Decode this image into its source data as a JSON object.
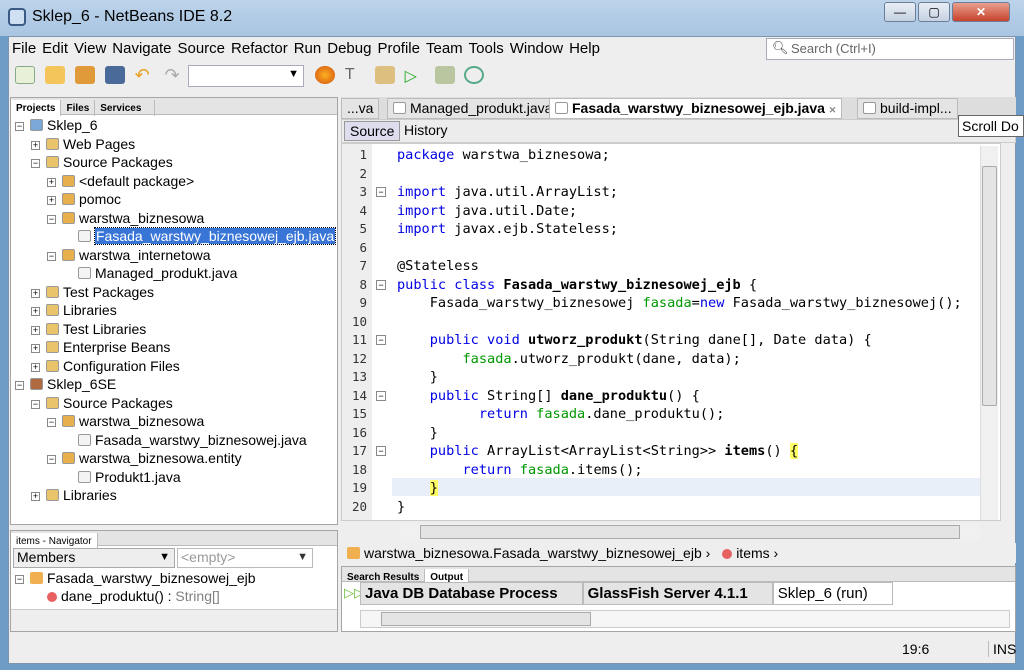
{
  "window": {
    "title": "Sklep_6 - NetBeans IDE 8.2"
  },
  "menu": [
    "File",
    "Edit",
    "View",
    "Navigate",
    "Source",
    "Refactor",
    "Run",
    "Debug",
    "Profile",
    "Team",
    "Tools",
    "Window",
    "Help"
  ],
  "search": {
    "placeholder": "Search (Ctrl+I)"
  },
  "projects": {
    "tabs": [
      "Projects",
      "Files",
      "Services"
    ],
    "tree": [
      {
        "label": "Sklep_6",
        "level": 0,
        "icon": "globe-icon"
      },
      {
        "label": "Web Pages",
        "level": 1,
        "icon": "folder-icon"
      },
      {
        "label": "Source Packages",
        "level": 1,
        "icon": "folder-icon"
      },
      {
        "label": "<default package>",
        "level": 2,
        "icon": "package-icon"
      },
      {
        "label": "pomoc",
        "level": 2,
        "icon": "package-icon"
      },
      {
        "label": "warstwa_biznesowa",
        "level": 2,
        "icon": "package-icon"
      },
      {
        "label": "Fasada_warstwy_biznesowej_ejb.java",
        "level": 3,
        "icon": "java-file-icon",
        "selected": true
      },
      {
        "label": "warstwa_internetowa",
        "level": 2,
        "icon": "package-icon"
      },
      {
        "label": "Managed_produkt.java",
        "level": 3,
        "icon": "java-file-icon"
      },
      {
        "label": "Test Packages",
        "level": 1,
        "icon": "folder-icon"
      },
      {
        "label": "Libraries",
        "level": 1,
        "icon": "folder-icon"
      },
      {
        "label": "Test Libraries",
        "level": 1,
        "icon": "folder-icon"
      },
      {
        "label": "Enterprise Beans",
        "level": 1,
        "icon": "folder-icon"
      },
      {
        "label": "Configuration Files",
        "level": 1,
        "icon": "folder-icon"
      },
      {
        "label": "Sklep_6SE",
        "level": 0,
        "icon": "coffee-cup-icon"
      },
      {
        "label": "Source Packages",
        "level": 1,
        "icon": "folder-icon"
      },
      {
        "label": "warstwa_biznesowa",
        "level": 2,
        "icon": "package-icon"
      },
      {
        "label": "Fasada_warstwy_biznesowej.java",
        "level": 3,
        "icon": "java-file-icon"
      },
      {
        "label": "warstwa_biznesowa.entity",
        "level": 2,
        "icon": "package-icon"
      },
      {
        "label": "Produkt1.java",
        "level": 3,
        "icon": "java-file-icon"
      },
      {
        "label": "Libraries",
        "level": 1,
        "icon": "folder-icon"
      }
    ]
  },
  "navigator": {
    "title": "items - Navigator",
    "members": "Members",
    "filter": "<empty>",
    "items": [
      {
        "label": "Fasada_warstwy_biznesowej_ejb"
      },
      {
        "label": "dane_produktu() : ",
        "type": "String[]"
      }
    ]
  },
  "editor": {
    "tabs": [
      "...va",
      "Managed_produkt.java",
      "Fasada_warstwy_biznesowej_ejb.java",
      "build-impl..."
    ],
    "active_tab": 2,
    "tooltip": "Scroll Do",
    "source": "Source",
    "history": "History",
    "lines": [
      "<span class=k>package</span> warstwa_biznesowa;",
      "",
      "<span class=k>import</span> java.util.ArrayList;",
      "<span class=k>import</span> java.util.Date;",
      "<span class=k>import</span> javax.ejb.Stateless;",
      "",
      "@Stateless",
      "<span class=k>public class</span> <span class=b>Fasada_warstwy_biznesowej_ejb</span> {",
      "    Fasada_warstwy_biznesowej <span class=f>fasada</span>=<span class=k>new</span> Fasada_warstwy_biznesowej();",
      "",
      "    <span class=k>public void</span> <span class=b>utworz_produkt</span>(String dane[], Date data) {",
      "        <span class=f>fasada</span>.utworz_produkt(dane, data);",
      "    }",
      "    <span class=k>public</span> String[] <span class=b>dane_produktu</span>() {",
      "          <span class=k>return</span> <span class=f>fasada</span>.dane_produktu();",
      "    }",
      "    <span class=k>public</span> ArrayList&lt;ArrayList&lt;String&gt;&gt; <span class=b>items</span>() <span style='background:#ffff66'>{</span>",
      "        <span class=k>return</span> <span class=f>fasada</span>.items();",
      "    <span style='background:#ffff66'>}</span>",
      "}"
    ],
    "breadcrumb": [
      "warstwa_biznesowa.Fasada_warstwy_biznesowej_ejb",
      "items"
    ]
  },
  "output": {
    "tabs": [
      "Search Results",
      "Output"
    ],
    "subtabs": [
      "Java DB Database Process",
      "GlassFish Server 4.1.1",
      "Sklep_6 (run)"
    ]
  },
  "status": {
    "position": "19:6",
    "mode": "INS"
  }
}
